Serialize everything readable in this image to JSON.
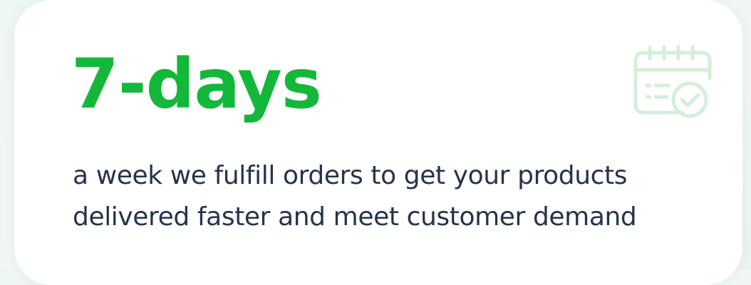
{
  "card": {
    "headline": "7-days",
    "description_lines": [
      "a week we fulfill orders to get your products",
      "delivered faster and meet customer demand"
    ],
    "icon": "calendar-check-icon"
  },
  "colors": {
    "headline": "#13b83a",
    "description": "#26334a",
    "icon": "#d4efd9",
    "card_background": "#ffffff"
  }
}
